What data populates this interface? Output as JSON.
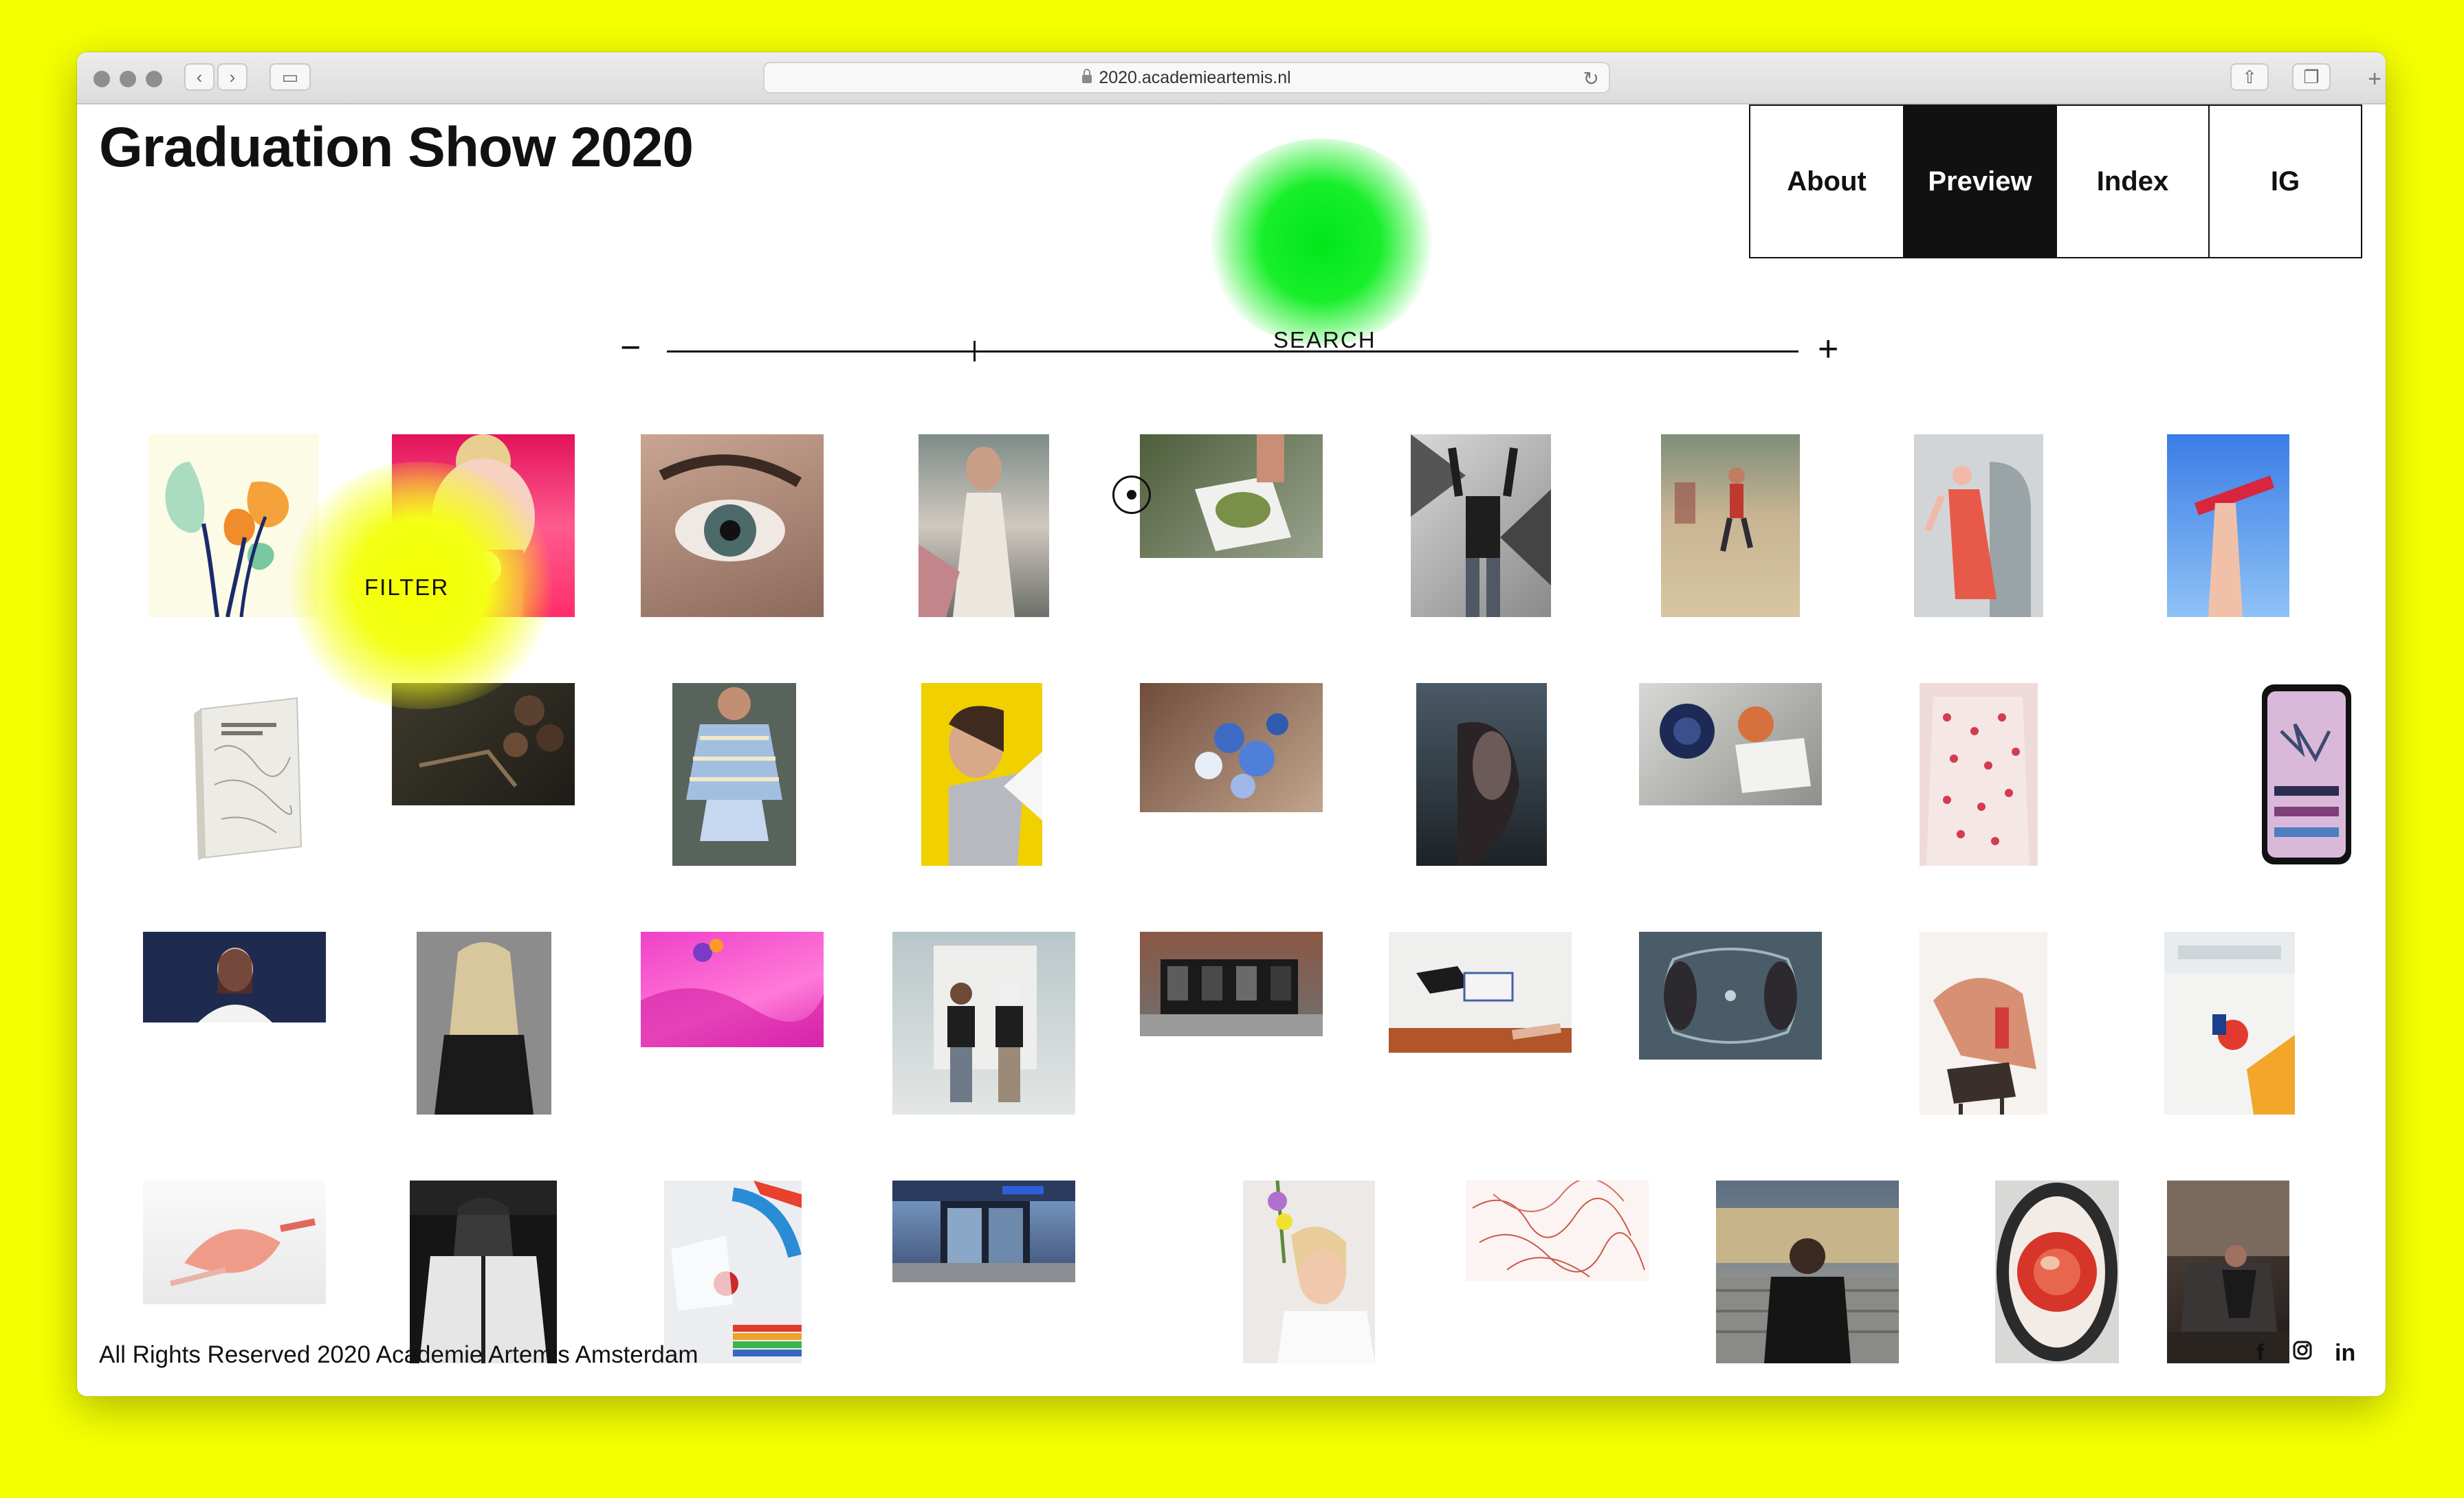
{
  "browser": {
    "url": "2020.academieartemis.nl"
  },
  "site": {
    "title": "Graduation Show 2020"
  },
  "nav": {
    "items": [
      {
        "label": "About",
        "active": false
      },
      {
        "label": "Preview",
        "active": true
      },
      {
        "label": "Index",
        "active": false
      },
      {
        "label": "IG",
        "active": false
      }
    ]
  },
  "controls": {
    "zoom_out": "−",
    "zoom_in": "+",
    "search": "SEARCH",
    "filter": "FILTER"
  },
  "colors": {
    "background": "#f4ff00",
    "search_glow": "#00e61b",
    "filter_glow": "#f3ff00",
    "active_nav": "#111111"
  },
  "footer": {
    "copyright": "All Rights Reserved 2020 Academie Artemis Amsterdam",
    "social": [
      "facebook-icon",
      "instagram-icon",
      "linkedin-icon"
    ]
  }
}
